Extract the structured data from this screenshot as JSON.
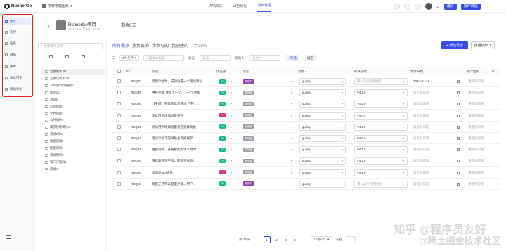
{
  "app": {
    "logo_text": "RunnerGo",
    "team_name": "项目管理团队"
  },
  "nav": [
    "API测试",
    "UI自动化",
    "项目管理"
  ],
  "topright": {
    "user_count": "11",
    "invite_label": "邀请",
    "log_label": "操作日志"
  },
  "sidebar": [
    {
      "label": "需求",
      "icon": "requirement-icon",
      "active": true
    },
    {
      "label": "迭代",
      "icon": "iteration-icon",
      "active": false
    },
    {
      "label": "任务",
      "icon": "task-icon",
      "active": false
    },
    {
      "label": "缺陷",
      "icon": "defect-icon",
      "active": false
    },
    {
      "label": "版本",
      "icon": "version-icon",
      "active": false
    },
    {
      "label": "测试用例",
      "icon": "testcase-icon",
      "active": false
    },
    {
      "label": "测试计划",
      "icon": "testplan-icon",
      "active": false
    }
  ],
  "project": {
    "name": "RunnerGo项目",
    "date_range": "2024-01-01至2024-01-15",
    "countdown": "剩余0天"
  },
  "tabs": {
    "items": [
      "所有需求",
      "我负责的",
      "我参与的",
      "我创建的"
    ],
    "count": "共39条",
    "new_button": "新建需求",
    "batch_button": "批量操作"
  },
  "tree": {
    "search_placeholder": "搜索模块名称",
    "items": [
      "全部需求 39",
      "无模块需求 18",
      "API测试需要管理1",
      "UI测试2",
      "测试1",
      "自助管理1",
      "文档管理1",
      "公共组件2",
      "需求管理模块1",
      "测试2外3",
      "数据测试2",
      "性能测试1",
      "测试用例3",
      "第三方接口1",
      "测试4"
    ]
  },
  "filters": {
    "level_select": "1个条件",
    "search_placeholder": "搜索ID标题",
    "status_label": "状态:",
    "status_placeholder": "状态",
    "owner_label": "负责人:",
    "owner_placeholder": "负责人",
    "filter_button": "筛选",
    "clear_button": "清空"
  },
  "table": {
    "headers": [
      "ID",
      "标题",
      "优先级",
      "状态",
      "负责人",
      "所属迭代",
      "预计开始",
      "预计结束"
    ],
    "rows": [
      {
        "id": "REQ40",
        "title": "新建计划时，支持设置一个测试目标",
        "priority": "P3",
        "status": "开发中",
        "owner": "gujing",
        "iteration": "输入迭代名称搜索",
        "iter_ph": true,
        "start": "2024-01-11",
        "start_ph": false
      },
      {
        "id": "REQ39",
        "title": "钟咚连播 增加上一个、下一个功能",
        "priority": "P3",
        "status": "未开始",
        "owner": "gujing",
        "iteration": "V4.2.0",
        "iter_ph": false,
        "start": "请选择日期",
        "start_ph": true
      },
      {
        "id": "REQ35",
        "title": "【生成】筛选的选项增加「空」...",
        "priority": "P3",
        "status": "未开始",
        "owner": "gujing",
        "iteration": "V4.1.0",
        "iter_ph": false,
        "start": "请选择日期",
        "start_ph": true
      },
      {
        "id": "REQ34",
        "title": "测试用例增加场景支持",
        "priority": "P1",
        "status": "未开始",
        "owner": "gujing",
        "iteration": "V4.0.0",
        "iter_ph": false,
        "start": "请选择日期",
        "start_ph": true
      },
      {
        "id": "REQ33",
        "title": "测试用例增加批量状态选择功能",
        "priority": "P3",
        "status": "未开始",
        "owner": "gujing",
        "iteration": "V4.2.0",
        "iter_ph": false,
        "start": "请选择日期",
        "start_ph": true
      },
      {
        "id": "REQ32",
        "title": "测试计划下的缺陷也有统展示",
        "priority": "P3",
        "status": "未开始",
        "owner": "gujing",
        "iteration": "V4.0.0",
        "iter_ph": false,
        "start": "请选择日期",
        "start_ph": true
      },
      {
        "id": "REQ31",
        "title": "性能测试，开发模式的请求时时...",
        "priority": "P3",
        "status": "未开始",
        "owner": "gujing",
        "iteration": "V4.1.0",
        "iter_ph": false,
        "start": "请选择日期",
        "start_ph": true
      },
      {
        "id": "REQ29",
        "title": "筛选的选项字段，前都只有原...",
        "priority": "P3",
        "status": "未开始",
        "owner": "gujing",
        "iteration": "V4.2.0",
        "iter_ph": false,
        "start": "请选择日期",
        "start_ph": true
      },
      {
        "id": "REQ28",
        "title": "新调速 api插件",
        "priority": "P1",
        "status": "未开始",
        "owner": "gujing",
        "iteration": "V4.1.0",
        "iter_ph": false,
        "start": "请选择日期",
        "start_ph": true
      },
      {
        "id": "REQ18",
        "title": "场景支持列表配置步骤，用户...",
        "priority": "P3",
        "status": "开发中",
        "owner": "gujing",
        "iteration": "输入迭代名称搜索",
        "iter_ph": true,
        "start": "请选择日期",
        "start_ph": true
      }
    ],
    "end_placeholder": "请选择日期"
  },
  "pagination": {
    "total": "共 33 条",
    "pages": [
      "1",
      "2",
      "3",
      "4"
    ],
    "page_size": "10 条/页",
    "goto_label": "前往"
  },
  "colors": {
    "accent": "#3a4de4",
    "p3": "#1ab394",
    "p1": "#d63384",
    "status_dev": "#8e44ad",
    "status_todo": "#9aa0a6"
  },
  "watermark": {
    "line1": "知乎 @程序员友好",
    "line2": "@稀土掘金技术社区"
  }
}
